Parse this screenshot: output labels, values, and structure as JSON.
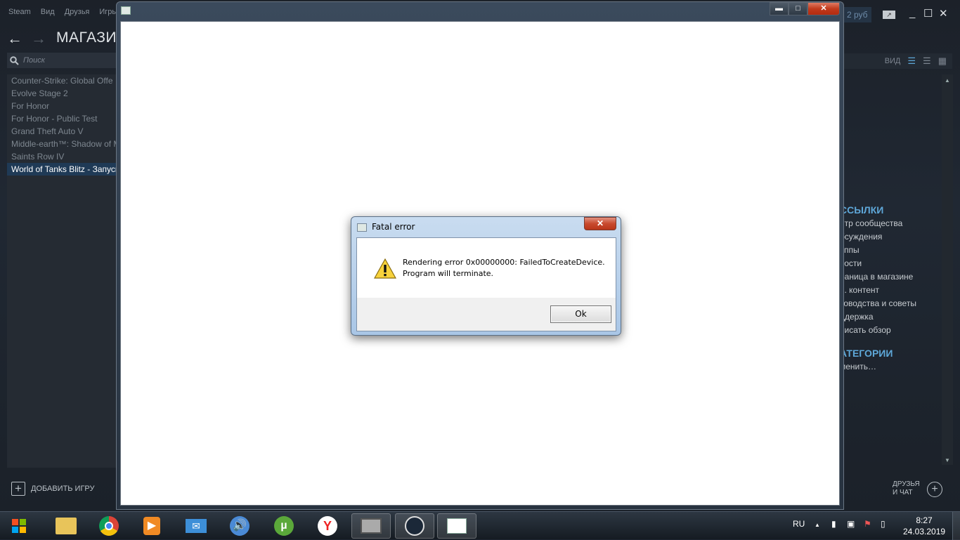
{
  "steam": {
    "menu": [
      "Steam",
      "Вид",
      "Друзья",
      "Игры"
    ],
    "title": "МАГАЗИ",
    "search_placeholder": "Поиск",
    "games": [
      {
        "label": "Counter-Strike: Global Offe",
        "selected": false
      },
      {
        "label": "Evolve Stage 2",
        "selected": false
      },
      {
        "label": "For Honor",
        "selected": false
      },
      {
        "label": "For Honor - Public Test",
        "selected": false
      },
      {
        "label": "Grand Theft Auto V",
        "selected": false
      },
      {
        "label": "Middle-earth™: Shadow of M",
        "selected": false
      },
      {
        "label": "Saints Row IV",
        "selected": false
      },
      {
        "label": "World of Tanks Blitz - Запуск",
        "selected": true
      }
    ],
    "add_game": "ДОБАВИТЬ ИГРУ",
    "balance": "2 руб",
    "view_label": "ВИД",
    "links_header": "ССЫЛКИ",
    "links": [
      "нтр сообщества",
      "бсуждения",
      "уппы",
      "вости",
      "раница в магазине",
      "п. контент",
      "ководства и советы",
      "ддержка",
      "писать обзор"
    ],
    "categories_header": "АТЕГОРИИ",
    "categories_link": "менить…",
    "friends_chat": [
      "ДРУЗЬЯ",
      "И ЧАТ"
    ],
    "accent": "#5ea7d8"
  },
  "dialog": {
    "title": "Fatal error",
    "message_line1": "Rendering error 0x00000000: FailedToCreateDevice.",
    "message_line2": "Program will terminate.",
    "ok_label": "Ok",
    "icon": "warning-icon"
  },
  "taskbar": {
    "apps": [
      "start",
      "file-explorer",
      "chrome",
      "media-player",
      "mail",
      "volume-app",
      "utorrent",
      "yandex-browser",
      "game-app",
      "steam",
      "blank-window"
    ],
    "language": "RU",
    "time": "8:27",
    "date": "24.03.2019"
  }
}
